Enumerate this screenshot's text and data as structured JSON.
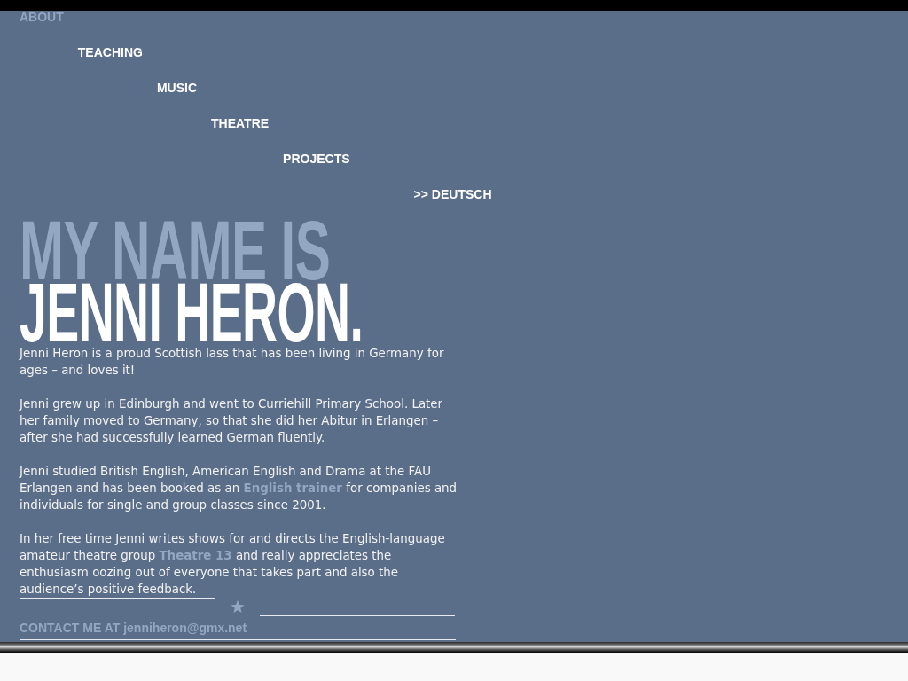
{
  "nav": {
    "items": [
      {
        "label": "ABOUT",
        "selected": true
      },
      {
        "label": "TEACHING",
        "selected": false
      },
      {
        "label": "MUSIC",
        "selected": false
      },
      {
        "label": "THEATRE",
        "selected": false
      },
      {
        "label": "PROJECTS",
        "selected": false
      }
    ],
    "language_link": ">> DEUTSCH"
  },
  "heading": {
    "lines": [
      {
        "text": "MY NAME IS",
        "kind": "intro"
      },
      {
        "text": "JENNI HERON.",
        "kind": "name"
      }
    ]
  },
  "paragraphs": [
    [
      {
        "kind": "text",
        "text": "Jenni Heron is a proud Scottish lass that has been living in Germany for ages – and loves it!"
      }
    ],
    [
      {
        "kind": "text",
        "text": "Jenni grew up in Edinburgh and went to Curriehill Primary School. Later her family moved to Germany, so that she did her Abitur in Erlangen – after she had successfully learned German fluently."
      }
    ],
    [
      {
        "kind": "text",
        "text": "Jenni studied British English, American English and Drama at the FAU Erlangen and has been booked as an "
      },
      {
        "kind": "link",
        "text": "English trainer"
      },
      {
        "kind": "text",
        "text": " for companies and individuals for single and group classes since 2001."
      }
    ],
    [
      {
        "kind": "text",
        "text": "In her free time Jenni writes shows for and directs the English-language amateur theatre group "
      },
      {
        "kind": "link",
        "text": "Theatre 13"
      },
      {
        "kind": "text",
        "text": " and really appreciates the enthusiasm oozing out of everyone that takes part and also the audience’s positive feedback."
      }
    ]
  ],
  "contact": {
    "text": "CONTACT ME AT jenniheron@gmx.net"
  }
}
